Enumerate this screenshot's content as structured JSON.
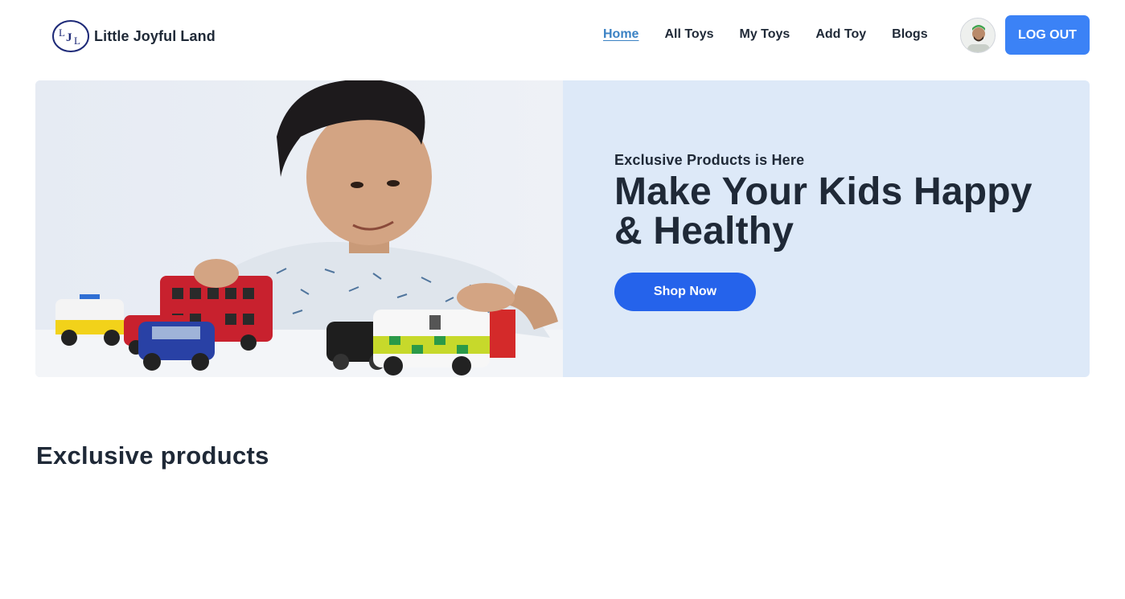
{
  "brand": {
    "logo_letters": "LJL",
    "name": "Little Joyful Land"
  },
  "nav": {
    "items": [
      {
        "label": "Home",
        "active": true
      },
      {
        "label": "All Toys",
        "active": false
      },
      {
        "label": "My Toys",
        "active": false
      },
      {
        "label": "Add Toy",
        "active": false
      },
      {
        "label": "Blogs",
        "active": false
      }
    ],
    "logout_label": "LOG OUT",
    "avatar_icon": "user-avatar"
  },
  "hero": {
    "kicker": "Exclusive Products is Here",
    "title": "Make Your Kids Happy & Healthy",
    "cta_label": "Shop Now",
    "image_icon": "boy-playing-with-toy-cars"
  },
  "sections": {
    "exclusive_title": "Exclusive products"
  },
  "colors": {
    "accent": "#3b82f6",
    "cta": "#2563eb",
    "hero_bg": "#dde9f8",
    "active_link": "#3b82c4",
    "text": "#1f2937"
  }
}
